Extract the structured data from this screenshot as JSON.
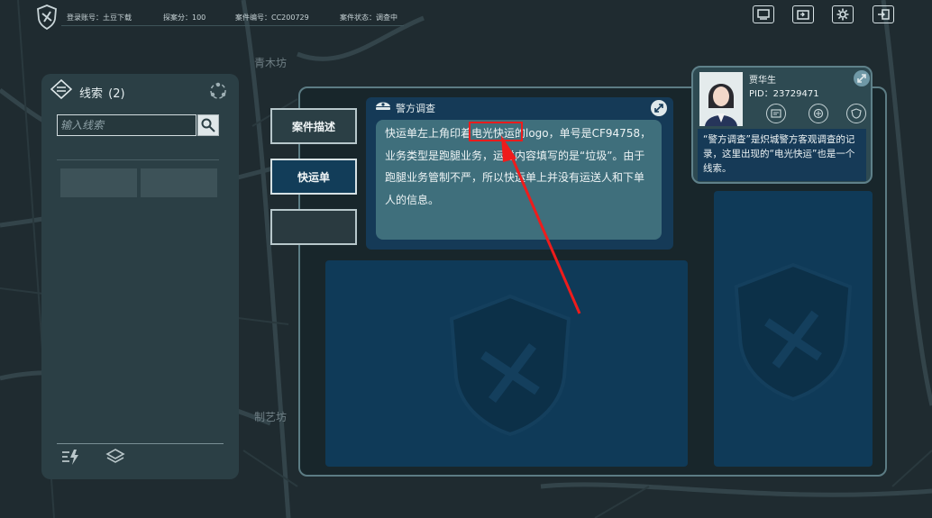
{
  "topbar": {
    "login_account": "登录账号：土豆下载",
    "score": "探案分：100",
    "case_number": "案件编号：CC200729",
    "case_status": "案件状态：调查中",
    "buttons": [
      "screen-icon",
      "import-icon",
      "settings-icon",
      "exit-icon"
    ]
  },
  "map": {
    "labels": [
      "青木坊",
      "制艺坊"
    ]
  },
  "clues": {
    "title": "线索",
    "count": "(2)",
    "search_placeholder": "输入线索"
  },
  "tabs": [
    {
      "label": "案件描述"
    },
    {
      "label": "快运单"
    },
    {
      "label": ""
    }
  ],
  "survey": {
    "title": "警方调查",
    "text": "快运单左上角印着电光快运的logo，单号是CF94758，业务类型是跑腿业务，运送内容填写的是“垃圾”。由于跑腿业务管制不严，所以快运单上并没有运送人和下单人的信息。"
  },
  "profile": {
    "name": "贾华生",
    "pid": "PID：23729471",
    "note": "“警方调查”是炽城警方客观调查的记录，这里出现的“电光快运”也是一个线索。"
  },
  "colors": {
    "accent_dark_blue": "#153a57",
    "panel": "#2b3f45",
    "highlight_red": "#ee1c1c"
  }
}
